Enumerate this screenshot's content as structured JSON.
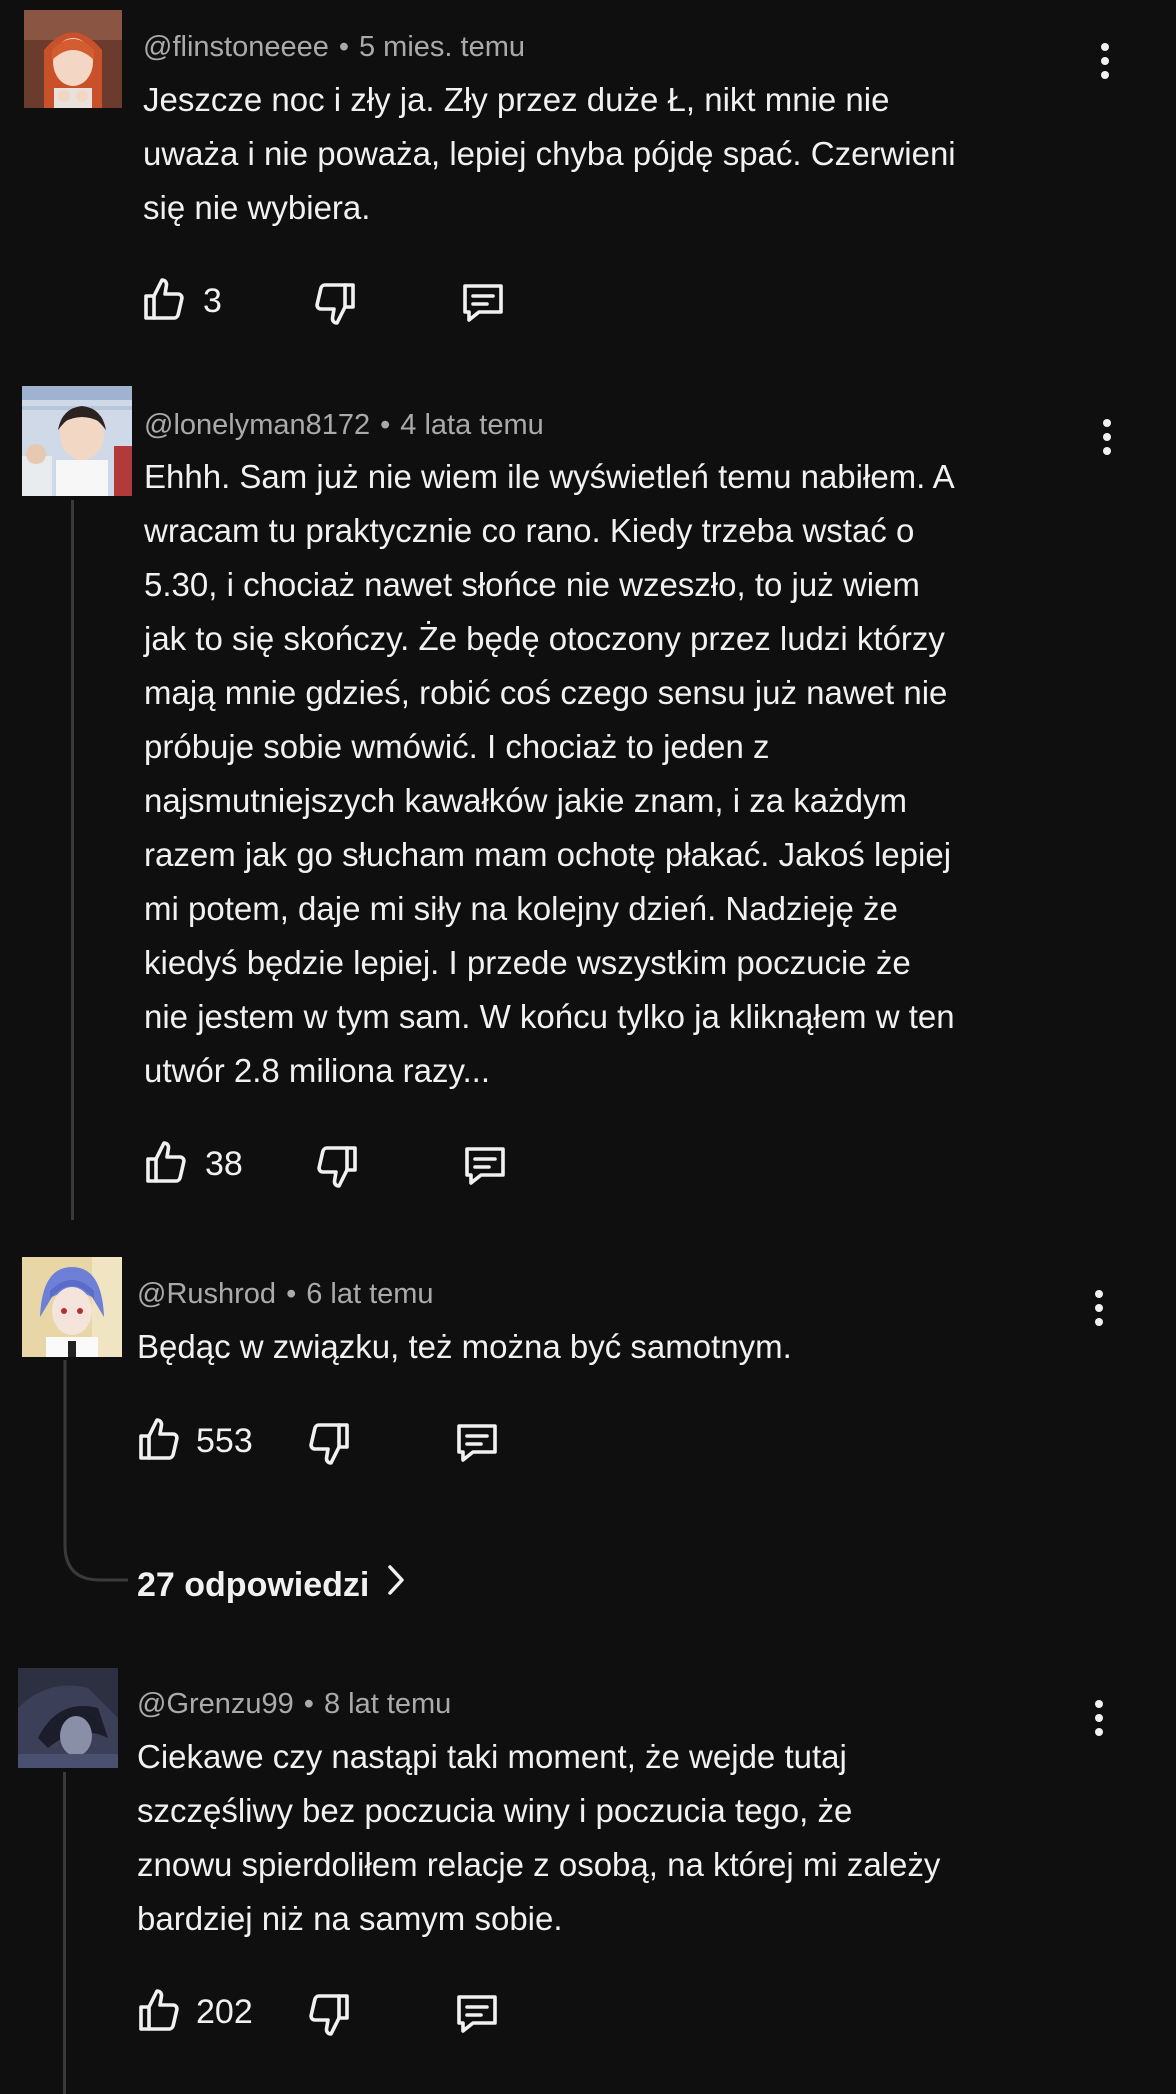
{
  "comments": [
    {
      "username": "@flinstoneeee",
      "time": "5 mies. temu",
      "text": "Jeszcze noc i zły ja. Zły przez duże Ł, nikt mnie nie\nuważa i nie poważa, lepiej chyba pójdę spać. Czerwieni\nsię nie wybiera.",
      "likes": "3"
    },
    {
      "username": "@lonelyman8172",
      "time": "4 lata temu",
      "text": "Ehhh. Sam już nie wiem ile wyświetleń temu nabiłem. A\nwracam tu praktycznie co rano. Kiedy trzeba wstać o\n5.30, i chociaż nawet słońce nie wzeszło, to już wiem\njak to się skończy. Że będę otoczony przez ludzi którzy\nmają mnie gdzieś, robić coś czego sensu już nawet nie\npróbuje sobie wmówić. I chociaż to jeden z\nnajsmutniejszych kawałków jakie znam, i za każdym\nrazem jak go słucham mam ochotę płakać. Jakoś lepiej\nmi potem, daje mi siły na kolejny dzień. Nadzieję że\nkiedyś będzie lepiej. I przede wszystkim poczucie że\nnie jestem w tym sam. W końcu tylko ja kliknąłem w ten\nutwór 2.8 miliona razy...",
      "likes": "38"
    },
    {
      "username": "@Rushrod",
      "time": "6 lat temu",
      "text": "Będąc w związku, też można być samotnym.",
      "likes": "553",
      "replies_label": "27 odpowiedzi"
    },
    {
      "username": "@Grenzu99",
      "time": "8 lat temu",
      "text": "Ciekawe czy nastąpi taki moment, że wejde tutaj\nszczęśliwy bez poczucia winy i poczucia tego, że\nznowu spierdoliłem relacje z osobą, na której mi zależy\nbardziej niż na samym sobie.",
      "likes": "202"
    }
  ],
  "icons": {
    "like": "thumbs-up-icon",
    "dislike": "thumbs-down-icon",
    "reply": "comment-icon",
    "more": "more-vertical-icon",
    "chevron": "chevron-right-icon"
  },
  "colors": {
    "background": "#0f0f0f",
    "text": "#f1f1f1",
    "meta": "#aaaaaa",
    "thread_line": "#3a3a3a"
  }
}
